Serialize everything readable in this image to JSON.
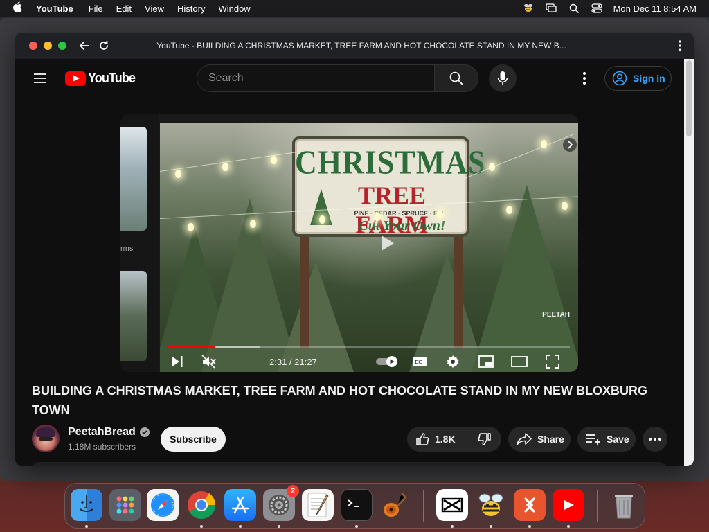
{
  "menubar": {
    "app_name": "YouTube",
    "items": [
      "File",
      "Edit",
      "View",
      "History",
      "Window"
    ],
    "clock": "Mon Dec 11  8:54 AM"
  },
  "browser": {
    "window_title": "YouTube - BUILDING A CHRISTMAS MARKET, TREE FARM AND HOT CHOCOLATE STAND IN MY NEW B..."
  },
  "header": {
    "logo_text": "YouTube",
    "search_placeholder": "Search",
    "sign_in_label": "Sign in"
  },
  "player": {
    "thumbnail_sign": {
      "line1": "CHRISTMAS",
      "line2": "TREE FARM",
      "line3": "PINE · CEDAR · SPRUCE · FIR",
      "line4": "Cut Your Own!"
    },
    "watermark": "PEETAH",
    "side_label": "rms",
    "time_display": "2:31 / 21:27",
    "progress_fraction": 0.1178,
    "buffer_fraction": 0.23
  },
  "video": {
    "title": "BUILDING A CHRISTMAS MARKET, TREE FARM AND HOT CHOCOLATE STAND IN MY NEW BLOXBURG TOWN",
    "channel_name": "PeetahBread",
    "subscribers": "1.18M subscribers",
    "subscribe_label": "Subscribe",
    "like_count": "1.8K",
    "share_label": "Share",
    "save_label": "Save"
  },
  "dock": {
    "settings_badge": "2"
  },
  "colors": {
    "accent_red": "#ff0000",
    "link_blue": "#3ea6ff",
    "background": "#0f0f0f"
  }
}
